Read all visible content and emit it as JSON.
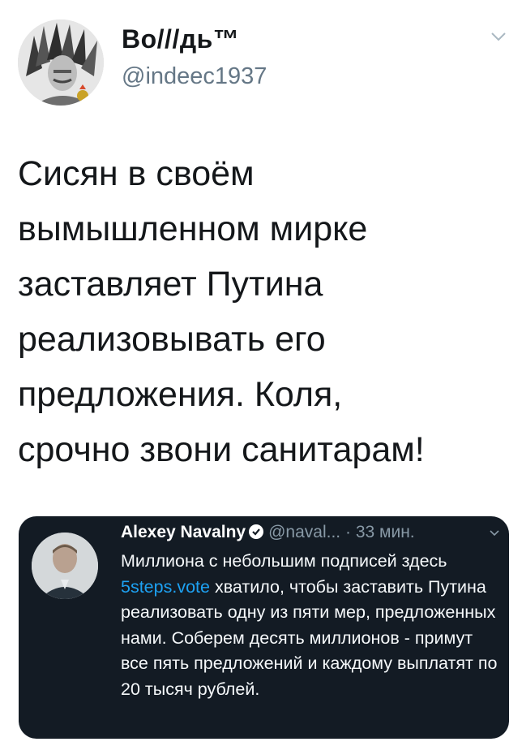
{
  "author": {
    "display_name": "Во///дь™",
    "handle": "@indeec1937"
  },
  "icons": {
    "menu": "chevron-down-icon",
    "verified": "verified-badge-icon"
  },
  "tweet": {
    "text": "Сисян в своём\nвымышленном мирке\nзаставляет Путина\nреализовывать его\nпредложения. Коля,\nсрочно звони санитарам!"
  },
  "quoted": {
    "name": "Alexey Navalny",
    "handle_truncated": "@naval...",
    "separator": "·",
    "time": "33 мин.",
    "text_before_link": "Миллиона с небольшим подписей здесь ",
    "link": "5steps.vote",
    "text_after_link": " хватило, чтобы заставить Путина реализовать одну из пяти мер, предложенных нами. Соберем десять миллионов - примут все пять предложений и каждому выплатят по 20 тысяч рублей."
  },
  "colors": {
    "primary_text": "#14171a",
    "secondary_text": "#657786",
    "embed_background": "#131b24",
    "link": "#1da1f2"
  }
}
